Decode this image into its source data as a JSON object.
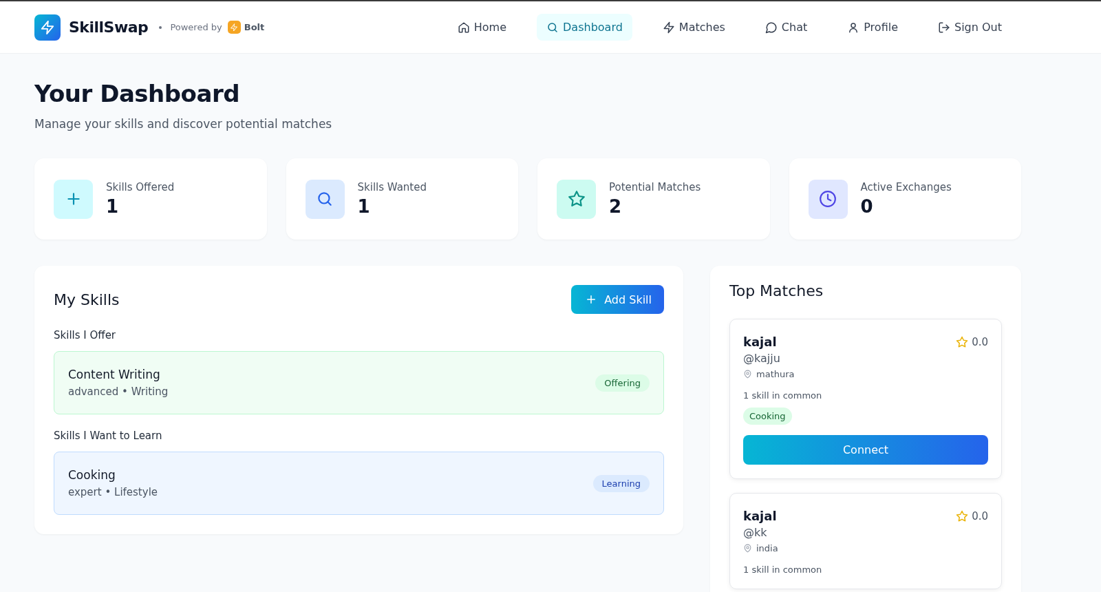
{
  "brand": {
    "name": "SkillSwap",
    "powered_by": "Powered by",
    "partner": "Bolt"
  },
  "nav": [
    {
      "label": "Home",
      "selected": false
    },
    {
      "label": "Dashboard",
      "selected": true
    },
    {
      "label": "Matches",
      "selected": false
    },
    {
      "label": "Chat",
      "selected": false
    },
    {
      "label": "Profile",
      "selected": false
    },
    {
      "label": "Sign Out",
      "selected": false
    }
  ],
  "page": {
    "title": "Your Dashboard",
    "subtitle": "Manage your skills and discover potential matches"
  },
  "stats": [
    {
      "label": "Skills Offered",
      "value": "1"
    },
    {
      "label": "Skills Wanted",
      "value": "1"
    },
    {
      "label": "Potential Matches",
      "value": "2"
    },
    {
      "label": "Active Exchanges",
      "value": "0"
    }
  ],
  "my_skills": {
    "title": "My Skills",
    "add_button": "Add Skill",
    "sections": [
      {
        "heading": "Skills I Offer",
        "kind": "offer",
        "items": [
          {
            "name": "Content Writing",
            "details": "advanced • Writing",
            "badge": "Offering"
          }
        ]
      },
      {
        "heading": "Skills I Want to Learn",
        "kind": "learn",
        "items": [
          {
            "name": "Cooking",
            "details": "expert • Lifestyle",
            "badge": "Learning"
          }
        ]
      }
    ]
  },
  "top_matches": {
    "title": "Top Matches",
    "matches": [
      {
        "name": "kajal",
        "handle": "@kajju",
        "location": "mathura",
        "rating": "0.0",
        "common": "1 skill in common",
        "tags": [
          "Cooking"
        ],
        "button": "Connect"
      },
      {
        "name": "kajal",
        "handle": "@kk",
        "location": "india",
        "rating": "0.0",
        "common": "1 skill in common"
      }
    ]
  }
}
